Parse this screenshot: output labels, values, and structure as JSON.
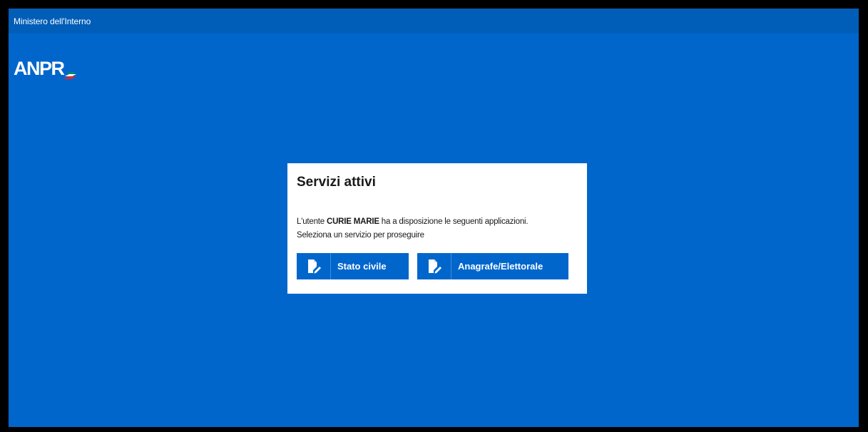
{
  "header": {
    "title": "Ministero dell'Interno"
  },
  "logo": {
    "text": "ANPR"
  },
  "card": {
    "title": "Servizi attivi",
    "intro_prefix": "L'utente ",
    "user_name": "CURIE MARIE",
    "intro_suffix": " ha a disposizione le seguenti applicazioni.",
    "instruction": "Seleziona un servizio per proseguire",
    "services": [
      {
        "label": "Stato civile",
        "icon": "document-edit-icon"
      },
      {
        "label": "Anagrafe/Elettorale",
        "icon": "document-edit-icon"
      }
    ]
  },
  "colors": {
    "background": "#0066cc",
    "header": "#005eb8",
    "button": "#0066cc",
    "card": "#ffffff",
    "flag_green": "#009246",
    "flag_red": "#ce2b37"
  }
}
